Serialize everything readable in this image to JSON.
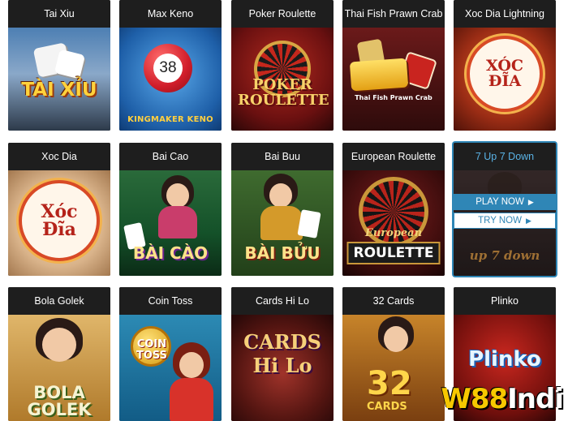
{
  "games": [
    {
      "title": "Tai Xiu",
      "logo": "TÀI XỈU"
    },
    {
      "title": "Max Keno",
      "logo": "KINGMAKER KENO",
      "ball_number": "38"
    },
    {
      "title": "Poker Roulette",
      "logo": "POKER ROULETTE"
    },
    {
      "title": "Thai Fish Prawn Crab",
      "logo": "Thai Fish Prawn Crab"
    },
    {
      "title": "Xoc Dia Lightning",
      "logo": "XÓC ĐĨA"
    },
    {
      "title": "Xoc Dia",
      "logo": "Xóc Đĩa"
    },
    {
      "title": "Bai Cao",
      "logo": "BÀI CÀO"
    },
    {
      "title": "Bai Buu",
      "logo": "BÀI BỬU"
    },
    {
      "title": "European Roulette",
      "logo": "ROULETTE",
      "logo_script": "European"
    },
    {
      "title": "7 Up 7 Down",
      "logo": "up 7 down"
    },
    {
      "title": "Bola Golek",
      "logo": "BOLA GOLEK"
    },
    {
      "title": "Coin Toss",
      "logo": "COIN TOSS"
    },
    {
      "title": "Cards Hi Lo",
      "logo": "CARDS Hi Lo"
    },
    {
      "title": "32 Cards",
      "logo": "32",
      "logo_sub": "CARDS"
    },
    {
      "title": "Plinko",
      "logo": "Plinko"
    }
  ],
  "hover_actions": {
    "play_now": "PLAY NOW",
    "try_now": "TRY NOW"
  },
  "watermark": {
    "part_a": "W88",
    "part_b": "Indi"
  },
  "colors": {
    "accent": "#2f86b6",
    "title_bar": "#1e1e1e",
    "watermark_yellow": "#f7c800"
  }
}
